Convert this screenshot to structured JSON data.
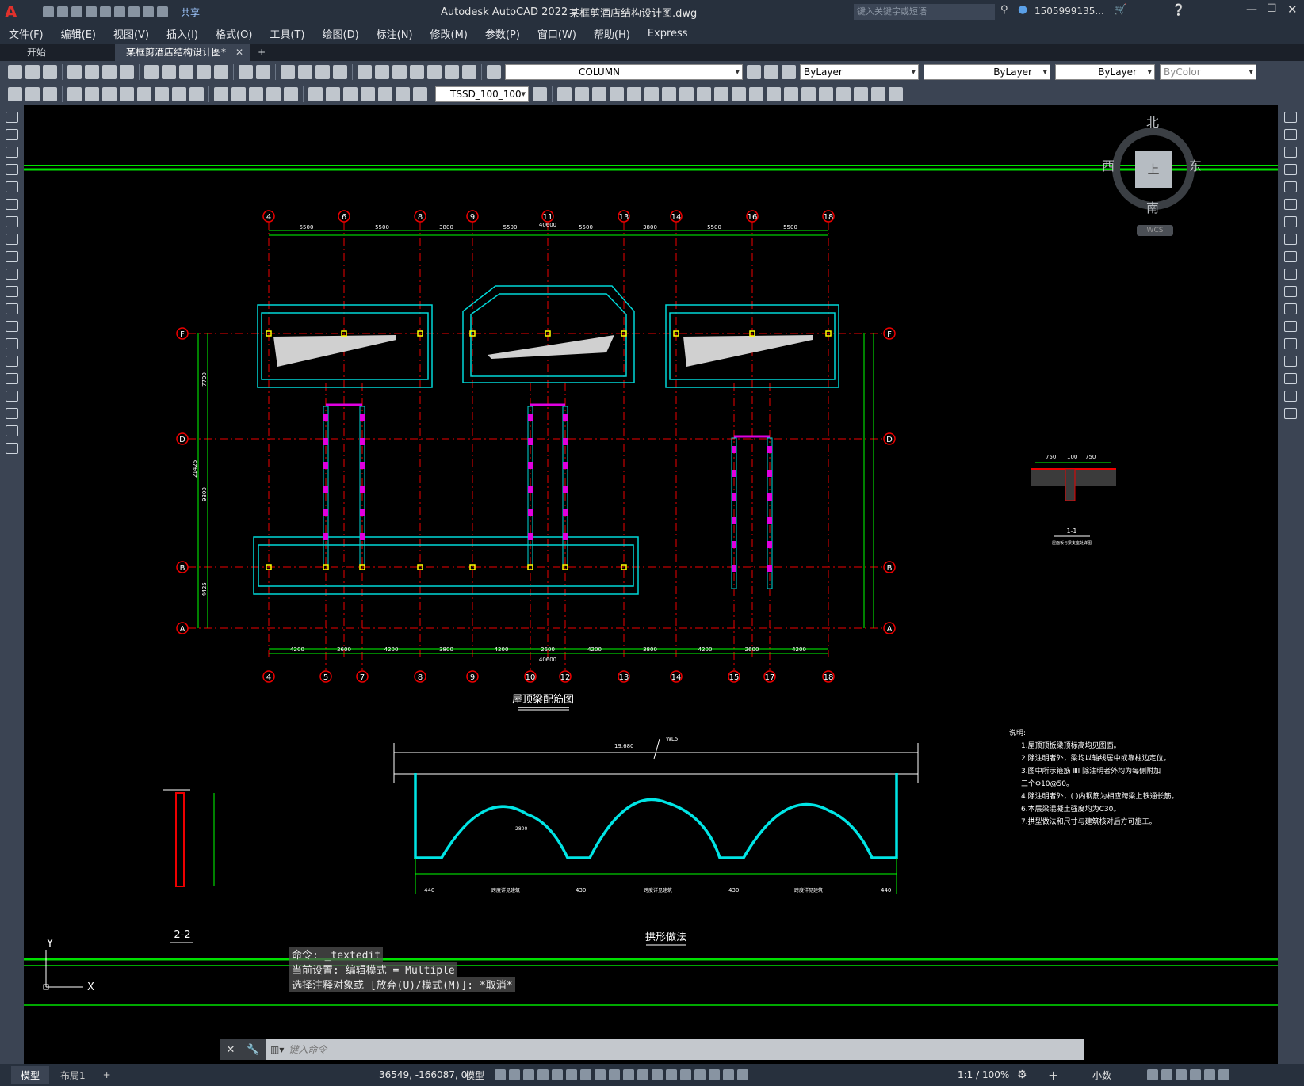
{
  "window": {
    "app_title": "Autodesk AutoCAD 2022",
    "file_title": "某框剪酒店结构设计图.dwg",
    "search_placeholder": "键入关键字或短语",
    "user": "1505999135...",
    "share": "共享"
  },
  "menu": [
    "文件(F)",
    "编辑(E)",
    "视图(V)",
    "插入(I)",
    "格式(O)",
    "工具(T)",
    "绘图(D)",
    "标注(N)",
    "修改(M)",
    "参数(P)",
    "窗口(W)",
    "帮助(H)",
    "Express"
  ],
  "tabs": {
    "start": "开始",
    "active": "某框剪酒店结构设计图*",
    "add": "+"
  },
  "toolbar": {
    "layer": "COLUMN",
    "color": "ByLayer",
    "linetype": "ByLayer",
    "lineweight": "ByLayer",
    "plotstyle": "ByColor",
    "textstyle": "TSSD_100_100"
  },
  "viewcube": {
    "north": "北",
    "south": "南",
    "west": "西",
    "east": "东",
    "face": "上",
    "wcs": "WCS"
  },
  "drawing": {
    "top_axes": [
      "4",
      "6",
      "8",
      "9",
      "11",
      "13",
      "14",
      "16",
      "18"
    ],
    "bottom_axes": [
      "4",
      "5",
      "7",
      "8",
      "9",
      "10",
      "12",
      "13",
      "14",
      "15",
      "17",
      "18"
    ],
    "row_axes": [
      "F",
      "D",
      "B",
      "A"
    ],
    "top_dims": [
      "5500",
      "5500",
      "3800",
      "5500",
      "5500",
      "3800",
      "5500",
      "5500"
    ],
    "top_total": "40600",
    "bottom_dims": [
      "4200",
      "2600",
      "4200",
      "3800",
      "4200",
      "2600",
      "4200",
      "3800",
      "4200",
      "2600",
      "4200"
    ],
    "bottom_total": "40600",
    "left_dims": [
      "7700",
      "21425",
      "9300",
      "4425"
    ],
    "plan_title": "屋顶梁配筋图",
    "arch_title": "拱形做法",
    "section_22": "2-2",
    "section_11": "1-1",
    "section_11_sub": "屋面板与梁支座处详图",
    "arch_dims": [
      "440",
      "430",
      "430",
      "440"
    ],
    "arch_labels": [
      "跨度详见建筑",
      "跨度详见建筑",
      "跨度详见建筑"
    ],
    "arch_elev": "19.680",
    "arch_tag": "WL5",
    "arch_radius": "2800",
    "detail_dims": [
      "750",
      "100",
      "750"
    ],
    "notes_title": "说明:",
    "notes": [
      "1.屋顶顶板梁顶标高均见图面。",
      "2.除注明者外，梁均以轴线居中或靠柱边定位。",
      "3.图中所示箍筋 ⅢⅠ 除注明者外均为每侧附加",
      "  三个Φ10@50。",
      "4.除注明者外，( )内钢筋为相应跨梁上铁通长筋。",
      "6.本层梁混凝土强度均为C30。",
      "7.拱型做法和尺寸与建筑核对后方可施工。"
    ]
  },
  "command": {
    "history": [
      "命令:  _textedit",
      "当前设置: 编辑模式 = Multiple",
      "选择注释对象或 [放弃(U)/模式(M)]: *取消*"
    ],
    "placeholder": "键入命令"
  },
  "layouts": [
    "模型",
    "布局1",
    "+"
  ],
  "status": {
    "coords": "36549, -166087, 0",
    "space": "模型",
    "scale": "1:1 / 100%",
    "units": "小数"
  }
}
